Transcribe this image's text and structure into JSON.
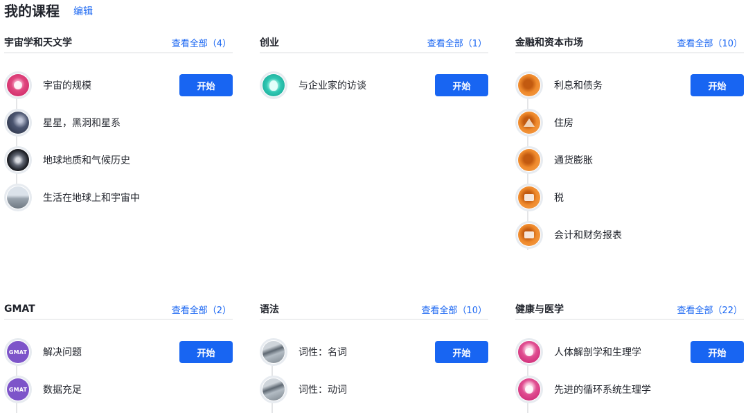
{
  "header": {
    "title": "我的课程",
    "edit_label": "编辑"
  },
  "start_label": "开始",
  "sections": [
    {
      "title": "宇宙学和天文学",
      "view_all": "查看全部（4）",
      "items": [
        "宇宙的规模",
        "星星，黑洞和星系",
        "地球地质和气候历史",
        "生活在地球上和宇宙中"
      ]
    },
    {
      "title": "创业",
      "view_all": "查看全部（1）",
      "items": [
        "与企业家的访谈"
      ]
    },
    {
      "title": "金融和资本市场",
      "view_all": "查看全部（10）",
      "items": [
        "利息和债务",
        "住房",
        "通货膨胀",
        "税",
        "会计和财务报表"
      ]
    },
    {
      "title": "GMAT",
      "view_all": "查看全部（2）",
      "items": [
        "解决问题",
        "数据充足"
      ]
    },
    {
      "title": "语法",
      "view_all": "查看全部（10）",
      "items": [
        "词性：名词",
        "词性：动词"
      ]
    },
    {
      "title": "健康与医学",
      "view_all": "查看全部（22）",
      "items": [
        "人体解剖学和生理学",
        "先进的循环系统生理学"
      ]
    }
  ],
  "icons": {
    "gmat_text": "GMAT",
    "names": [
      "galaxy-icon",
      "black-hole-icon",
      "earth-icon",
      "landscape-icon",
      "lightbulb-icon",
      "coin-icon",
      "house-icon",
      "inflation-icon",
      "tax-icon",
      "ledger-icon",
      "gmat-icon",
      "grammar-icon",
      "anatomy-icon"
    ]
  },
  "colors": {
    "accent": "#1865f2",
    "text": "#21242c",
    "divider": "#eeeff0"
  }
}
